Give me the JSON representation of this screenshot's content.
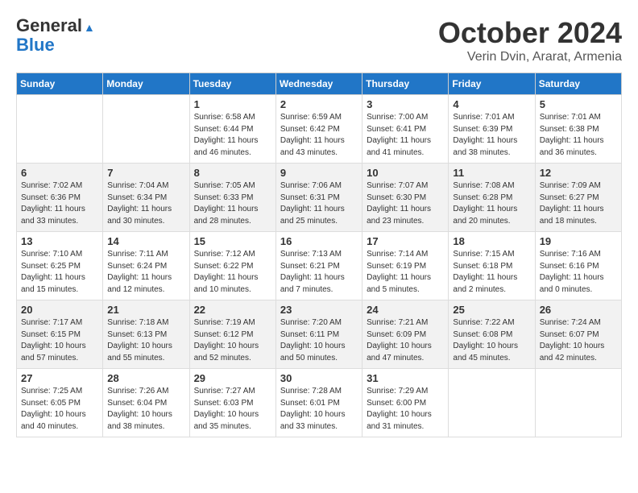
{
  "header": {
    "logo_line1": "General",
    "logo_line2": "Blue",
    "month_title": "October 2024",
    "location": "Verin Dvin, Ararat, Armenia"
  },
  "weekdays": [
    "Sunday",
    "Monday",
    "Tuesday",
    "Wednesday",
    "Thursday",
    "Friday",
    "Saturday"
  ],
  "weeks": [
    [
      {
        "day": "",
        "sunrise": "",
        "sunset": "",
        "daylight": ""
      },
      {
        "day": "",
        "sunrise": "",
        "sunset": "",
        "daylight": ""
      },
      {
        "day": "1",
        "sunrise": "Sunrise: 6:58 AM",
        "sunset": "Sunset: 6:44 PM",
        "daylight": "Daylight: 11 hours and 46 minutes."
      },
      {
        "day": "2",
        "sunrise": "Sunrise: 6:59 AM",
        "sunset": "Sunset: 6:42 PM",
        "daylight": "Daylight: 11 hours and 43 minutes."
      },
      {
        "day": "3",
        "sunrise": "Sunrise: 7:00 AM",
        "sunset": "Sunset: 6:41 PM",
        "daylight": "Daylight: 11 hours and 41 minutes."
      },
      {
        "day": "4",
        "sunrise": "Sunrise: 7:01 AM",
        "sunset": "Sunset: 6:39 PM",
        "daylight": "Daylight: 11 hours and 38 minutes."
      },
      {
        "day": "5",
        "sunrise": "Sunrise: 7:01 AM",
        "sunset": "Sunset: 6:38 PM",
        "daylight": "Daylight: 11 hours and 36 minutes."
      }
    ],
    [
      {
        "day": "6",
        "sunrise": "Sunrise: 7:02 AM",
        "sunset": "Sunset: 6:36 PM",
        "daylight": "Daylight: 11 hours and 33 minutes."
      },
      {
        "day": "7",
        "sunrise": "Sunrise: 7:04 AM",
        "sunset": "Sunset: 6:34 PM",
        "daylight": "Daylight: 11 hours and 30 minutes."
      },
      {
        "day": "8",
        "sunrise": "Sunrise: 7:05 AM",
        "sunset": "Sunset: 6:33 PM",
        "daylight": "Daylight: 11 hours and 28 minutes."
      },
      {
        "day": "9",
        "sunrise": "Sunrise: 7:06 AM",
        "sunset": "Sunset: 6:31 PM",
        "daylight": "Daylight: 11 hours and 25 minutes."
      },
      {
        "day": "10",
        "sunrise": "Sunrise: 7:07 AM",
        "sunset": "Sunset: 6:30 PM",
        "daylight": "Daylight: 11 hours and 23 minutes."
      },
      {
        "day": "11",
        "sunrise": "Sunrise: 7:08 AM",
        "sunset": "Sunset: 6:28 PM",
        "daylight": "Daylight: 11 hours and 20 minutes."
      },
      {
        "day": "12",
        "sunrise": "Sunrise: 7:09 AM",
        "sunset": "Sunset: 6:27 PM",
        "daylight": "Daylight: 11 hours and 18 minutes."
      }
    ],
    [
      {
        "day": "13",
        "sunrise": "Sunrise: 7:10 AM",
        "sunset": "Sunset: 6:25 PM",
        "daylight": "Daylight: 11 hours and 15 minutes."
      },
      {
        "day": "14",
        "sunrise": "Sunrise: 7:11 AM",
        "sunset": "Sunset: 6:24 PM",
        "daylight": "Daylight: 11 hours and 12 minutes."
      },
      {
        "day": "15",
        "sunrise": "Sunrise: 7:12 AM",
        "sunset": "Sunset: 6:22 PM",
        "daylight": "Daylight: 11 hours and 10 minutes."
      },
      {
        "day": "16",
        "sunrise": "Sunrise: 7:13 AM",
        "sunset": "Sunset: 6:21 PM",
        "daylight": "Daylight: 11 hours and 7 minutes."
      },
      {
        "day": "17",
        "sunrise": "Sunrise: 7:14 AM",
        "sunset": "Sunset: 6:19 PM",
        "daylight": "Daylight: 11 hours and 5 minutes."
      },
      {
        "day": "18",
        "sunrise": "Sunrise: 7:15 AM",
        "sunset": "Sunset: 6:18 PM",
        "daylight": "Daylight: 11 hours and 2 minutes."
      },
      {
        "day": "19",
        "sunrise": "Sunrise: 7:16 AM",
        "sunset": "Sunset: 6:16 PM",
        "daylight": "Daylight: 11 hours and 0 minutes."
      }
    ],
    [
      {
        "day": "20",
        "sunrise": "Sunrise: 7:17 AM",
        "sunset": "Sunset: 6:15 PM",
        "daylight": "Daylight: 10 hours and 57 minutes."
      },
      {
        "day": "21",
        "sunrise": "Sunrise: 7:18 AM",
        "sunset": "Sunset: 6:13 PM",
        "daylight": "Daylight: 10 hours and 55 minutes."
      },
      {
        "day": "22",
        "sunrise": "Sunrise: 7:19 AM",
        "sunset": "Sunset: 6:12 PM",
        "daylight": "Daylight: 10 hours and 52 minutes."
      },
      {
        "day": "23",
        "sunrise": "Sunrise: 7:20 AM",
        "sunset": "Sunset: 6:11 PM",
        "daylight": "Daylight: 10 hours and 50 minutes."
      },
      {
        "day": "24",
        "sunrise": "Sunrise: 7:21 AM",
        "sunset": "Sunset: 6:09 PM",
        "daylight": "Daylight: 10 hours and 47 minutes."
      },
      {
        "day": "25",
        "sunrise": "Sunrise: 7:22 AM",
        "sunset": "Sunset: 6:08 PM",
        "daylight": "Daylight: 10 hours and 45 minutes."
      },
      {
        "day": "26",
        "sunrise": "Sunrise: 7:24 AM",
        "sunset": "Sunset: 6:07 PM",
        "daylight": "Daylight: 10 hours and 42 minutes."
      }
    ],
    [
      {
        "day": "27",
        "sunrise": "Sunrise: 7:25 AM",
        "sunset": "Sunset: 6:05 PM",
        "daylight": "Daylight: 10 hours and 40 minutes."
      },
      {
        "day": "28",
        "sunrise": "Sunrise: 7:26 AM",
        "sunset": "Sunset: 6:04 PM",
        "daylight": "Daylight: 10 hours and 38 minutes."
      },
      {
        "day": "29",
        "sunrise": "Sunrise: 7:27 AM",
        "sunset": "Sunset: 6:03 PM",
        "daylight": "Daylight: 10 hours and 35 minutes."
      },
      {
        "day": "30",
        "sunrise": "Sunrise: 7:28 AM",
        "sunset": "Sunset: 6:01 PM",
        "daylight": "Daylight: 10 hours and 33 minutes."
      },
      {
        "day": "31",
        "sunrise": "Sunrise: 7:29 AM",
        "sunset": "Sunset: 6:00 PM",
        "daylight": "Daylight: 10 hours and 31 minutes."
      },
      {
        "day": "",
        "sunrise": "",
        "sunset": "",
        "daylight": ""
      },
      {
        "day": "",
        "sunrise": "",
        "sunset": "",
        "daylight": ""
      }
    ]
  ]
}
